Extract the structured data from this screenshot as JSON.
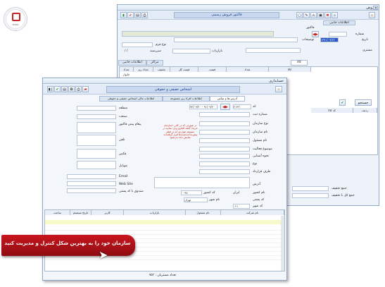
{
  "logo": {
    "text": "PODO"
  },
  "sales": {
    "title": "فروش",
    "header_title": "فاکتور فروش رسمی",
    "tab_info": "اطلاعات جانبی",
    "doc_label": "فاکتور",
    "number_label": "شماره",
    "date_label": "تاریخ",
    "date_value": "۱۳۹۱/۰۹/۲۲",
    "desc_label": "توضیحات",
    "customer_label": "مشتری",
    "form_type_label": "نوع فرم",
    "marketer_label": "بازاریاب",
    "due_label": "سررسید",
    "due_value": "/ /",
    "tabs": [
      "کالا",
      "مراکز",
      "اطلاعات جانبی"
    ],
    "cols": [
      "کالا",
      "تعداد",
      "قیمت",
      "قیمت کل",
      "تخفیف",
      "تعداد ریز",
      "تعداد خانوار"
    ],
    "sum_tax": "جمع تخفیف",
    "sum_total": "جمع کل با تخفیف",
    "right_cols": [
      "ردیف",
      "کد کالا"
    ],
    "find_label": "جستجو"
  },
  "people": {
    "title": "حسابداری",
    "header_title": "اشخاص حقیقی و حقوقی",
    "tabs": [
      "آدرس ها و تماس",
      "اطلاعات افراد زیر مجموعه",
      "اطلاعات مالی اشخاص حقیقی و حقوقی"
    ],
    "code_label": "کد",
    "code_value": "۲۱۳۲",
    "range_value": "۹۲/۰۹/۲۰ - ۹۱/۰۹/۲۰",
    "fields": [
      "شماره ثبت",
      "نوع سازمان",
      "نام سازمان",
      "نام مسئول",
      "موضوع فعالیت",
      "نحوه آشنایی",
      "نوع",
      "طرف قرارداد",
      "آدرس",
      "نام کشور",
      "کد پستی"
    ],
    "left_fields": [
      "منطقه",
      "صنعت",
      "پیغام پیش فاکتور",
      "تلفن",
      "فکس",
      "موبایل",
      "Email",
      "Web Site",
      "صندوق با کد پستی"
    ],
    "note": "در صورتی که در کادر «سازمان خرید» کلمه الجاوی وارد نمایید در سیستم مواردی که در فیلتر پیش‌ساخت‌شده‌ها قرار گرفته‌اند، نمایش داده می‌شود",
    "country_value": "ایران",
    "country_code_label": "کد کشور",
    "country_code_value": "۰۰۹۸",
    "city_label": "نام شهر",
    "city_value": "تهران",
    "city_code_label": "کد شهر",
    "city_code_value": "۰۲۱",
    "grid_cols": [
      "نام شرکت",
      "نام مسئول",
      "بازاریاب",
      "کاربر",
      "تاریخ سیستم",
      "ساعت"
    ],
    "total_label": "تعداد مشتریان : ۹۵۳"
  },
  "banner": {
    "text": "سازمان خود را به بهترین شکل کنترل و مدیریت کنید"
  },
  "colors": {
    "accent": "#b5121b",
    "title": "#1b3f8f"
  }
}
